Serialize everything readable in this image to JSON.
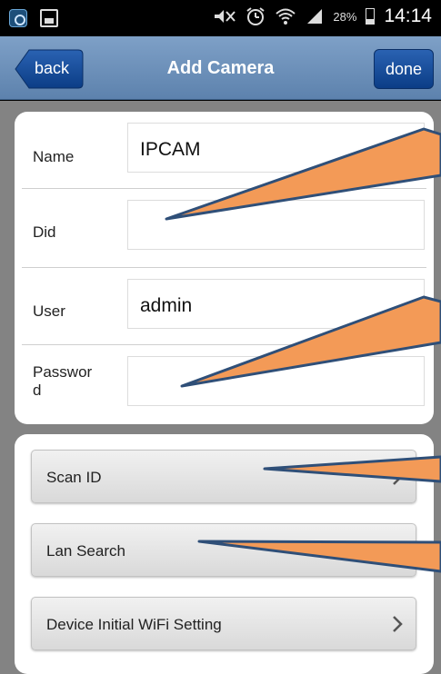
{
  "status_bar": {
    "battery_pct": "28%",
    "time": "14:14",
    "icons": [
      "app-notification-icon",
      "image-notification-icon",
      "mute-icon",
      "alarm-icon",
      "wifi-icon",
      "signal-icon",
      "battery-icon"
    ]
  },
  "nav": {
    "back_label": "back",
    "title": "Add Camera",
    "done_label": "done"
  },
  "form": {
    "name_label": "Name",
    "name_value": "IPCAM",
    "did_label": "Did",
    "did_value": "",
    "user_label": "User",
    "user_value": "admin",
    "password_label_line1": "Passwor",
    "password_label_line2": "d",
    "password_value": ""
  },
  "actions": {
    "scan_id": "Scan ID",
    "lan_search": "Lan Search",
    "wifi_setting": "Device Initial WiFi Setting"
  },
  "colors": {
    "nav_bar": "#6a8db7",
    "done_button": "#1a4f9c",
    "arrow_fill": "#f39a57",
    "arrow_stroke": "#2f4f78"
  }
}
